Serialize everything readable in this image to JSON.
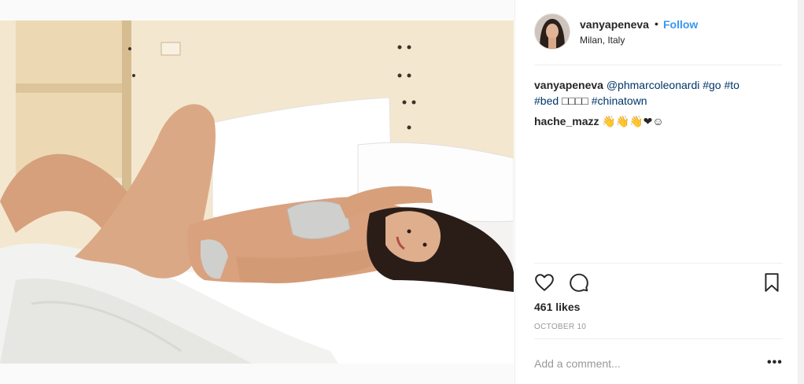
{
  "post": {
    "username": "vanyapeneva",
    "separator": "•",
    "follow_label": "Follow",
    "location": "Milan, Italy",
    "caption": {
      "username": "vanyapeneva",
      "mention": "@phmarcoleonardi",
      "tag_go": "#go",
      "tag_to": "#to",
      "tag_bed": "#bed",
      "boxes": "□□□□",
      "tag_chinatown": "#chinatown"
    },
    "comments": [
      {
        "username": "hache_mazz",
        "text": "👋👋👋❤☺"
      }
    ],
    "likes_text": "461 likes",
    "date": "OCTOBER 10",
    "comment_placeholder": "Add a comment...",
    "more_label": "•••"
  },
  "icons": {
    "like": "heart-icon",
    "comment": "comment-bubble-icon",
    "save": "bookmark-icon",
    "more": "ellipsis-icon"
  },
  "colors": {
    "link_blue": "#3897f0",
    "hashtag": "#003569",
    "muted": "#999999",
    "text": "#262626"
  }
}
